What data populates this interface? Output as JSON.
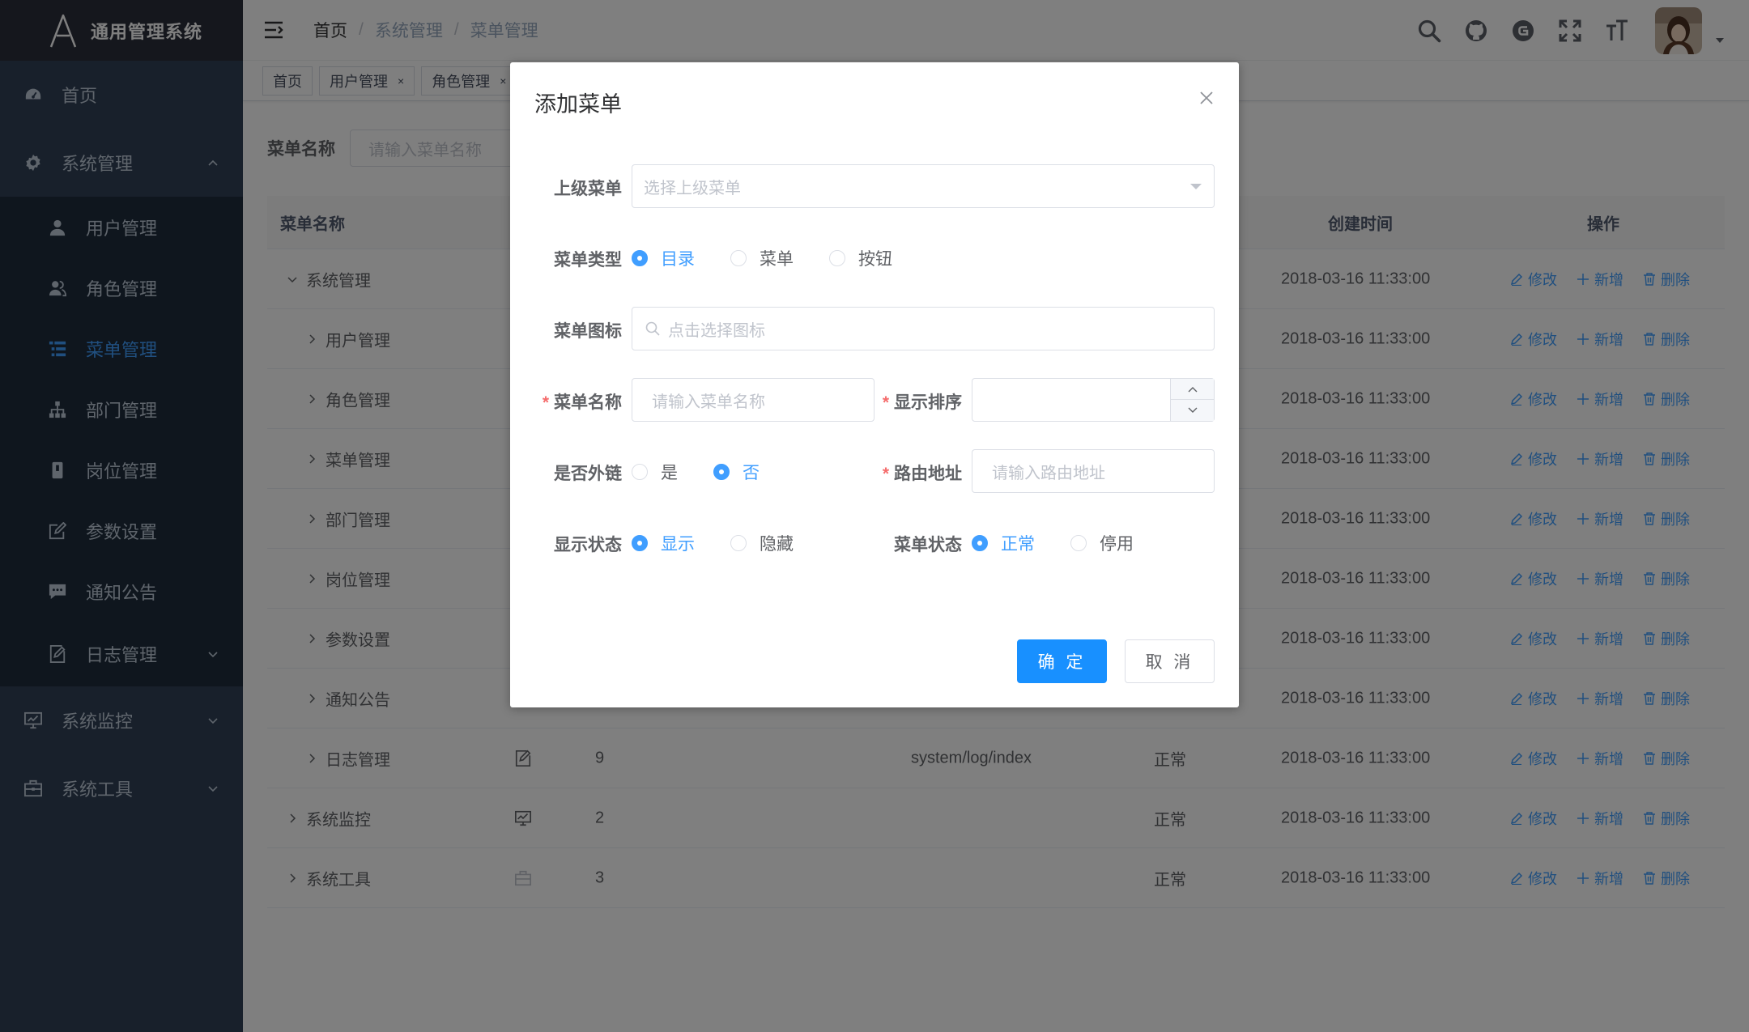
{
  "app": {
    "title": "通用管理系统"
  },
  "sidebar": {
    "home": "首页",
    "system": "系统管理",
    "sub_items": [
      {
        "label": "用户管理",
        "icon": "user-icon"
      },
      {
        "label": "角色管理",
        "icon": "peoples-icon"
      },
      {
        "label": "菜单管理",
        "icon": "tree-table-icon",
        "active": true
      },
      {
        "label": "部门管理",
        "icon": "tree-icon"
      },
      {
        "label": "岗位管理",
        "icon": "post-icon"
      },
      {
        "label": "参数设置",
        "icon": "edit-icon"
      },
      {
        "label": "通知公告",
        "icon": "message-icon"
      },
      {
        "label": "日志管理",
        "icon": "log-icon"
      }
    ],
    "monitor": "系统监控",
    "tool": "系统工具"
  },
  "breadcrumb": [
    "首页",
    "系统管理",
    "菜单管理"
  ],
  "tags": [
    "首页",
    "用户管理",
    "角色管理"
  ],
  "search": {
    "label": "菜单名称",
    "placeholder": "请输入菜单名称"
  },
  "table": {
    "headers": {
      "name": "菜单名称",
      "created": "创建时间",
      "actions": "操作"
    },
    "ops": {
      "edit": "修改",
      "add": "新增",
      "delete": "删除"
    },
    "rows": [
      {
        "name": "系统管理",
        "level": 0,
        "expanded": true,
        "created": "2018-03-16 11:33:00"
      },
      {
        "name": "用户管理",
        "level": 1,
        "created": "2018-03-16 11:33:00"
      },
      {
        "name": "角色管理",
        "level": 1,
        "created": "2018-03-16 11:33:00"
      },
      {
        "name": "菜单管理",
        "level": 1,
        "created": "2018-03-16 11:33:00"
      },
      {
        "name": "部门管理",
        "level": 1,
        "created": "2018-03-16 11:33:00"
      },
      {
        "name": "岗位管理",
        "level": 1,
        "created": "2018-03-16 11:33:00"
      },
      {
        "name": "参数设置",
        "level": 1,
        "created": "2018-03-16 11:33:00"
      },
      {
        "name": "通知公告",
        "level": 1,
        "created": "2018-03-16 11:33:00"
      },
      {
        "name": "日志管理",
        "level": 1,
        "icon": "log-icon",
        "order": "9",
        "path": "system/log/index",
        "status": "正常",
        "created": "2018-03-16 11:33:00"
      },
      {
        "name": "系统监控",
        "level": 0,
        "icon": "monitor-icon",
        "order": "2",
        "path": "",
        "status": "正常",
        "created": "2018-03-16 11:33:00"
      },
      {
        "name": "系统工具",
        "level": 0,
        "icon": "tool-icon",
        "order": "3",
        "path": "",
        "status": "正常",
        "created": "2018-03-16 11:33:00"
      }
    ]
  },
  "dialog": {
    "title": "添加菜单",
    "parent": {
      "label": "上级菜单",
      "placeholder": "选择上级菜单"
    },
    "type": {
      "label": "菜单类型",
      "options": [
        "目录",
        "菜单",
        "按钮"
      ],
      "selected": "目录"
    },
    "icon": {
      "label": "菜单图标",
      "placeholder": "点击选择图标"
    },
    "name": {
      "label": "菜单名称",
      "placeholder": "请输入菜单名称"
    },
    "order": {
      "label": "显示排序",
      "value": ""
    },
    "external": {
      "label": "是否外链",
      "options": [
        "是",
        "否"
      ],
      "selected": "否"
    },
    "route": {
      "label": "路由地址",
      "placeholder": "请输入路由地址"
    },
    "visible": {
      "label": "显示状态",
      "options": [
        "显示",
        "隐藏"
      ],
      "selected": "显示"
    },
    "status": {
      "label": "菜单状态",
      "options": [
        "正常",
        "停用"
      ],
      "selected": "正常"
    },
    "confirm": "确 定",
    "cancel": "取 消"
  },
  "colors": {
    "primary": "#1890ff",
    "link": "#409eff",
    "sidebar": "#304156",
    "submenu": "#1f2d3d"
  }
}
